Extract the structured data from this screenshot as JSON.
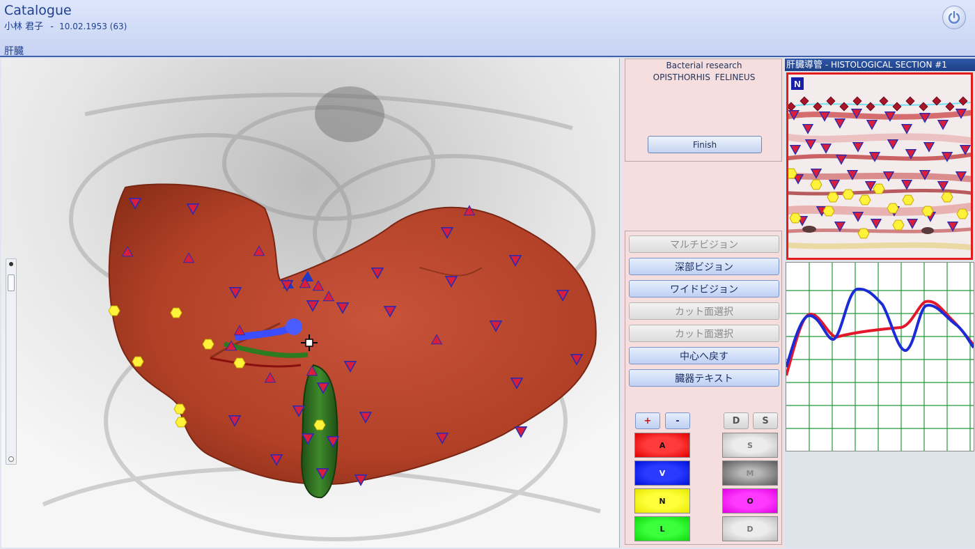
{
  "header": {
    "app_title": "Catalogue",
    "patient_name": "小林 君子",
    "separator": "-",
    "patient_dob_age": "10.02.1953 (63)",
    "organ": "肝臓",
    "power_icon": "power-icon"
  },
  "research": {
    "title": "Bacterial research",
    "organism": "OPISTHORHIS FELINEUS",
    "finish_label": "Finish"
  },
  "menu": {
    "items": [
      {
        "label": "マルチビジョン",
        "state": "disabled"
      },
      {
        "label": "深部ビジョン",
        "state": "active"
      },
      {
        "label": "ワイドビジョン",
        "state": "active"
      },
      {
        "label": "カット面選択",
        "state": "disabled"
      },
      {
        "label": "カット面選択",
        "state": "disabled"
      },
      {
        "label": "中心へ戻す",
        "state": "active"
      },
      {
        "label": "臓器テキスト",
        "state": "active"
      }
    ],
    "plus_label": "+",
    "minus_label": "-",
    "d_label": "D",
    "s_label": "S",
    "left_colors": [
      {
        "label": "A",
        "color": "#ff2020"
      },
      {
        "label": "V",
        "color": "#1020ff"
      },
      {
        "label": "N",
        "color": "#ffff20"
      },
      {
        "label": "L",
        "color": "#20ff20"
      }
    ],
    "right_colors": [
      {
        "label": "S",
        "color": "#dcdcdc"
      },
      {
        "label": "M",
        "color": "#7a7a7a"
      },
      {
        "label": "O",
        "color": "#ff20ff"
      },
      {
        "label": "D",
        "color": "#dcdcdc"
      }
    ]
  },
  "section": {
    "organ": "肝臓導管",
    "title": " - HISTOLOGICAL SECTION #1",
    "marker_label": "N"
  },
  "colors": {
    "liver": "#b8442a",
    "gallbladder": "#2d6a1e",
    "marker_triangle": "#d81e3a",
    "marker_outline": "#2b2bb0",
    "marker_hexagon": "#fff23a",
    "graph_red": "#e3182a",
    "graph_blue": "#1b2bd6",
    "graph_grid": "#1f9a3a"
  }
}
